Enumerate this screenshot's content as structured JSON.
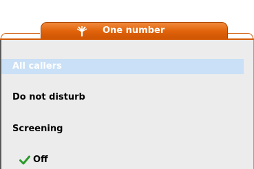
{
  "tab": {
    "title": "One number",
    "icon": "one-number-icon",
    "color": "#e1620a"
  },
  "menu": {
    "items": [
      {
        "label": "All callers",
        "selected": false,
        "highlighted": true
      },
      {
        "label": "Do not disturb",
        "selected": false,
        "highlighted": false
      },
      {
        "label": "Screening",
        "selected": false,
        "highlighted": false
      },
      {
        "label": "Off",
        "selected": true,
        "highlighted": false
      }
    ],
    "highlight_color": "#c9e0f6",
    "check_icon": "check-icon",
    "check_color": "#2a9a2a"
  }
}
